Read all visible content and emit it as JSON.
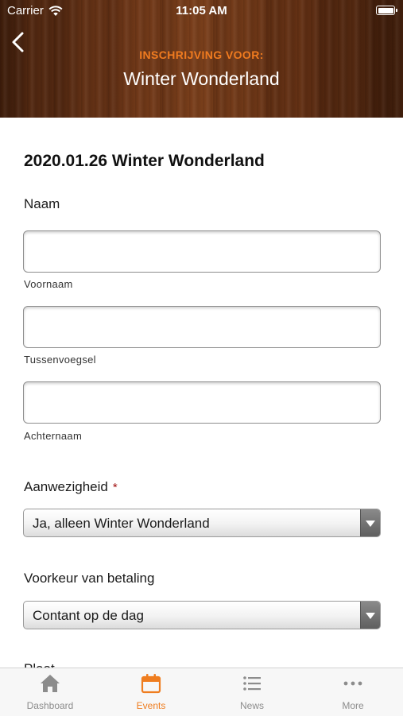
{
  "status": {
    "carrier": "Carrier",
    "time": "11:05 AM"
  },
  "header": {
    "subtitle": "INSCHRIJVING VOOR:",
    "title": "Winter Wonderland"
  },
  "form": {
    "event_title": "2020.01.26 Winter Wonderland",
    "name_label": "Naam",
    "first_name": {
      "value": "",
      "sublabel": "Voornaam"
    },
    "middle_name": {
      "value": "",
      "sublabel": "Tussenvoegsel"
    },
    "last_name": {
      "value": "",
      "sublabel": "Achternaam"
    },
    "attendance": {
      "label": "Aanwezigheid",
      "required_mark": "*",
      "selected": "Ja, alleen Winter Wonderland"
    },
    "payment": {
      "label": "Voorkeur van betaling",
      "selected": "Contant op de dag"
    },
    "next_label_partial": "Plaat"
  },
  "tabs": [
    {
      "label": "Dashboard",
      "icon": "home-icon",
      "active": false
    },
    {
      "label": "Events",
      "icon": "calendar-icon",
      "active": true
    },
    {
      "label": "News",
      "icon": "list-icon",
      "active": false
    },
    {
      "label": "More",
      "icon": "more-dots-icon",
      "active": false
    }
  ],
  "colors": {
    "accent": "#ef7d1f",
    "tab_inactive": "#8c8c8c",
    "required": "#a01010"
  }
}
